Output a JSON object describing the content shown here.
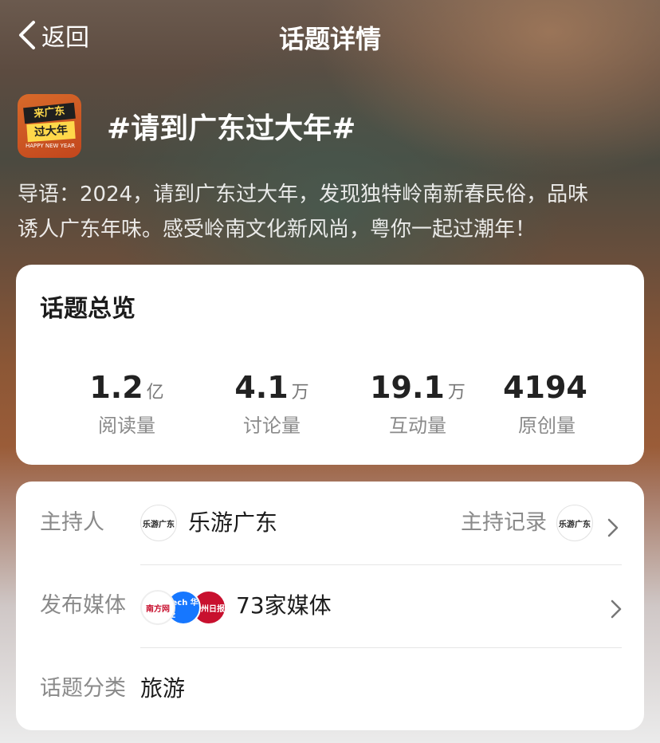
{
  "nav": {
    "back_label": "返回",
    "title": "话题详情"
  },
  "topic": {
    "icon_lines": [
      "来广东",
      "过大年",
      "HAPPY NEW YEAR"
    ],
    "title": "#请到广东过大年#",
    "intro_line1": "导语：2024，请到广东过大年，发现独特岭南新春民俗，品味",
    "intro_line2": "诱人广东年味。感受岭南文化新风尚，粤你一起过潮年！"
  },
  "overview": {
    "title": "话题总览",
    "stats": [
      {
        "value": "1.2",
        "unit": "亿",
        "label": "阅读量"
      },
      {
        "value": "4.1",
        "unit": "万",
        "label": "讨论量"
      },
      {
        "value": "19.1",
        "unit": "万",
        "label": "互动量"
      },
      {
        "value": "4194",
        "unit": "",
        "label": "原创量"
      }
    ]
  },
  "details": {
    "host": {
      "label": "主持人",
      "avatar_text": "乐游广东",
      "name": "乐游广东",
      "record_label": "主持记录",
      "record_avatar_text": "乐游广东"
    },
    "media": {
      "label": "发布媒体",
      "avatars": [
        "南方网",
        "Tech 华经",
        "广州日报"
      ],
      "count_label": "73家媒体"
    },
    "category": {
      "label": "话题分类",
      "value": "旅游"
    }
  },
  "colors": {
    "card_bg": "#ffffff",
    "label_gray": "#8a8a8a",
    "media_blue": "#1677ff",
    "media_red": "#c8102e"
  }
}
